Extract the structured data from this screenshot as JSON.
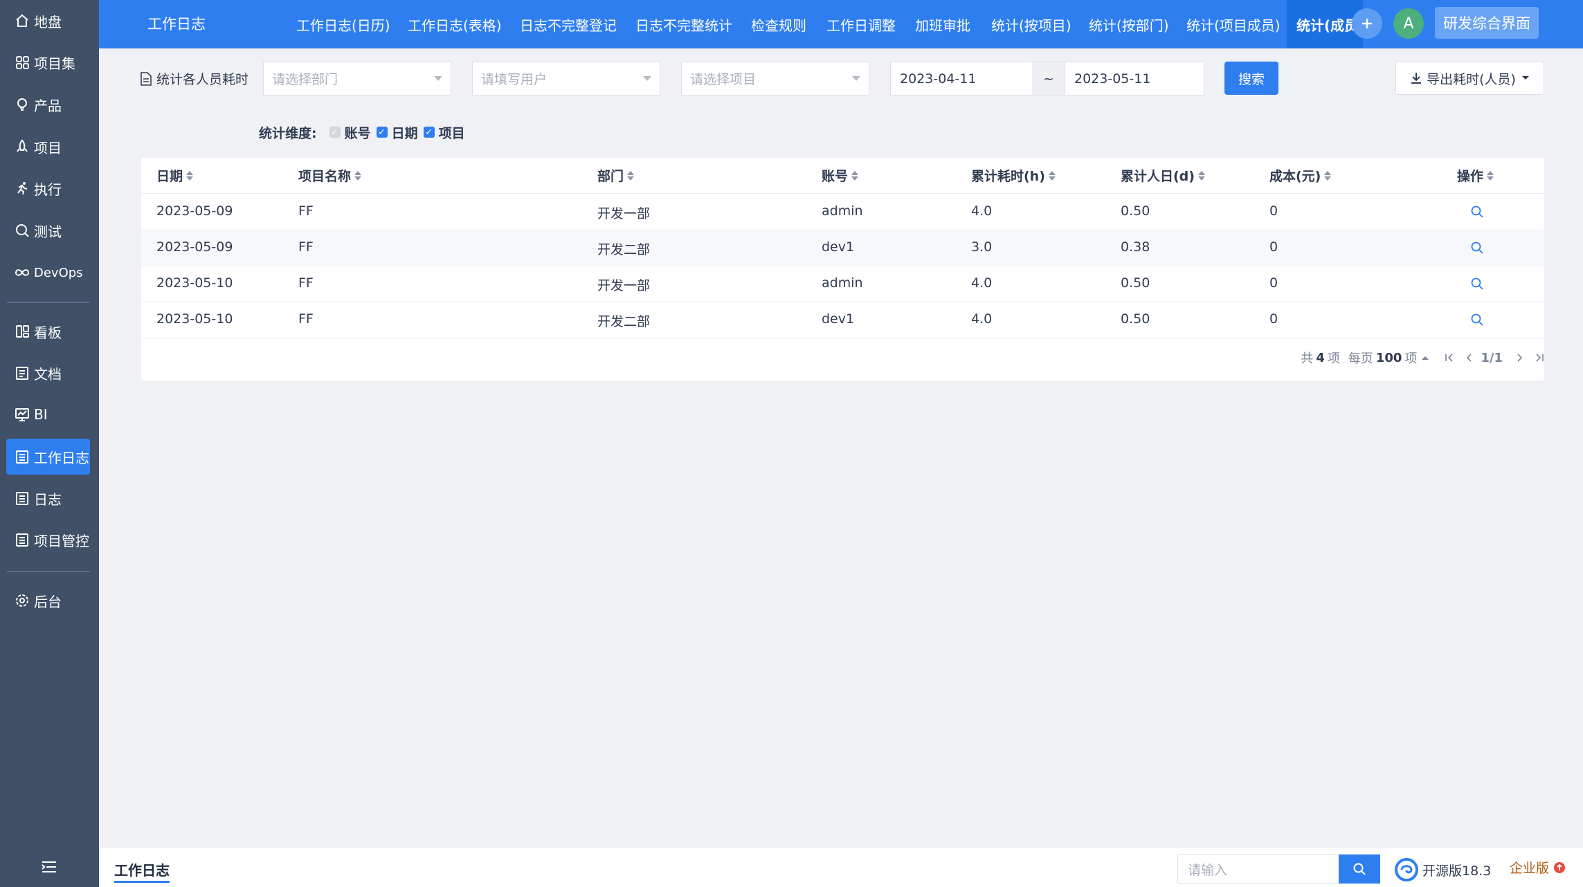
{
  "sidebar": {
    "items": [
      {
        "label": "地盘",
        "icon": "home-icon"
      },
      {
        "label": "项目集",
        "icon": "grid-icon"
      },
      {
        "label": "产品",
        "icon": "bulb-icon"
      },
      {
        "label": "项目",
        "icon": "rocket-icon"
      },
      {
        "label": "执行",
        "icon": "run-icon"
      },
      {
        "label": "测试",
        "icon": "search-icon"
      },
      {
        "label": "DevOps",
        "icon": "infinity-icon"
      },
      {
        "label": "看板",
        "icon": "kanban-icon"
      },
      {
        "label": "文档",
        "icon": "doc-icon"
      },
      {
        "label": "BI",
        "icon": "monitor-icon"
      },
      {
        "label": "工作日志",
        "icon": "log-icon"
      },
      {
        "label": "日志",
        "icon": "list-icon"
      },
      {
        "label": "项目管控",
        "icon": "list-icon"
      },
      {
        "label": "后台",
        "icon": "gear-icon"
      }
    ],
    "active_index": 10
  },
  "topbar": {
    "title": "工作日志",
    "tabs": [
      "工作日志(日历)",
      "工作日志(表格)",
      "日志不完整登记",
      "日志不完整统计",
      "检查规则",
      "工作日调整",
      "加班审批",
      "统计(按项目)",
      "统计(按部门)",
      "统计(项目成员)",
      "统计(成员"
    ],
    "active_tab_index": 10,
    "avatar_letter": "A",
    "rd_button": "研发综合界面"
  },
  "filters": {
    "label": "统计各人员耗时",
    "dept_placeholder": "请选择部门",
    "user_placeholder": "请填写用户",
    "project_placeholder": "请选择项目",
    "date_start": "2023-04-11",
    "date_sep": "~",
    "date_end": "2023-05-11",
    "search_label": "搜索",
    "export_label": "导出耗时(人员)"
  },
  "dimensions": {
    "label": "统计维度:",
    "options": [
      {
        "label": "账号",
        "checked": true,
        "disabled": true
      },
      {
        "label": "日期",
        "checked": true,
        "disabled": false
      },
      {
        "label": "项目",
        "checked": true,
        "disabled": false
      }
    ]
  },
  "table": {
    "columns": [
      "日期",
      "项目名称",
      "部门",
      "账号",
      "累计耗时(h)",
      "累计人日(d)",
      "成本(元)",
      "操作"
    ],
    "rows": [
      [
        "2023-05-09",
        "FF",
        "开发一部",
        "admin",
        "4.0",
        "0.50",
        "0"
      ],
      [
        "2023-05-09",
        "FF",
        "开发二部",
        "dev1",
        "3.0",
        "0.38",
        "0"
      ],
      [
        "2023-05-10",
        "FF",
        "开发一部",
        "admin",
        "4.0",
        "0.50",
        "0"
      ],
      [
        "2023-05-10",
        "FF",
        "开发二部",
        "dev1",
        "4.0",
        "0.50",
        "0"
      ]
    ]
  },
  "pager": {
    "total_prefix": "共",
    "total": "4",
    "total_suffix": "项",
    "per_page_prefix": "每页",
    "per_page": "100",
    "per_page_suffix": "项",
    "page": "1/1"
  },
  "footer": {
    "title": "工作日志",
    "search_placeholder": "请输入",
    "version": "开源版18.3",
    "enterprise": "企业版"
  },
  "colors": {
    "primary": "#2e7ef0",
    "sidebar": "#3f5067",
    "avatar": "#4caf7d"
  }
}
